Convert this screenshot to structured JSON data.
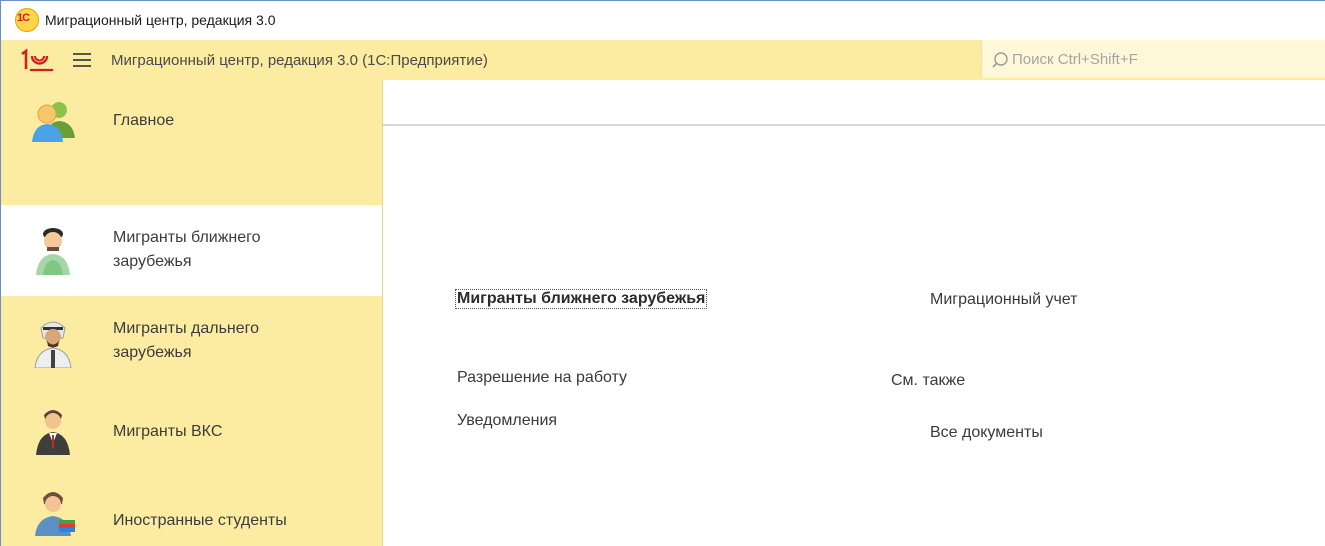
{
  "window": {
    "title": "Миграционный центр, редакция 3.0",
    "logo_text": "1С"
  },
  "appbar": {
    "title": "Миграционный центр, редакция 3.0  (1С:Предприятие)",
    "search_placeholder": "Поиск Ctrl+Shift+F"
  },
  "sidebar": {
    "items": [
      {
        "label": "Главное",
        "icon": "users-group-icon",
        "active": false
      },
      {
        "label": "Мигранты ближнего зарубежья",
        "icon": "migrant-near-icon",
        "active": true
      },
      {
        "label": "Мигранты дальнего зарубежья",
        "icon": "migrant-far-icon",
        "active": false
      },
      {
        "label": "Мигранты ВКС",
        "icon": "specialist-icon",
        "active": false
      },
      {
        "label": "Иностранные студенты",
        "icon": "student-icon",
        "active": false
      }
    ]
  },
  "content": {
    "section_heading": "Мигранты ближнего зарубежья",
    "links_left": [
      "Разрешение на работу",
      "Уведомления"
    ],
    "migration_accounting": "Миграционный учет",
    "see_also": "См. также",
    "all_documents": "Все документы"
  },
  "colors": {
    "panel_yellow": "#fbeca2",
    "active_item": "#ffffff",
    "accent_red": "#d11e1e"
  }
}
